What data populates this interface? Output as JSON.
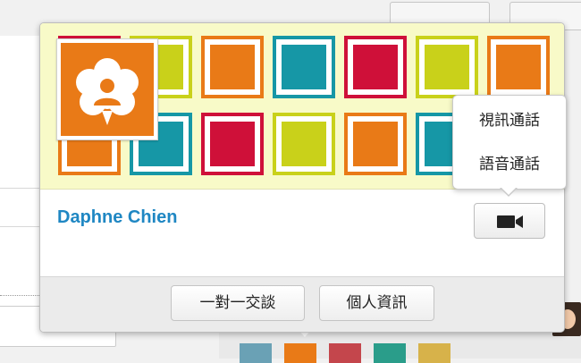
{
  "card": {
    "contact_name": "Daphne Chien",
    "avatar_icon": "user-chat-bubble-icon",
    "video_button_icon": "video-camera-icon",
    "footer_buttons": {
      "chat_label": "一對一交談",
      "profile_label": "個人資訊"
    },
    "cover_colors": {
      "background": "#f8fac8",
      "orange": "#e97a17",
      "teal": "#1697a6",
      "red": "#cf1039",
      "lime": "#c9d11a"
    }
  },
  "call_menu": {
    "video_call_label": "視訊通話",
    "voice_call_label": "語音通話"
  },
  "colors": {
    "name_link": "#1f87c3",
    "avatar_bg": "#e97a17"
  }
}
